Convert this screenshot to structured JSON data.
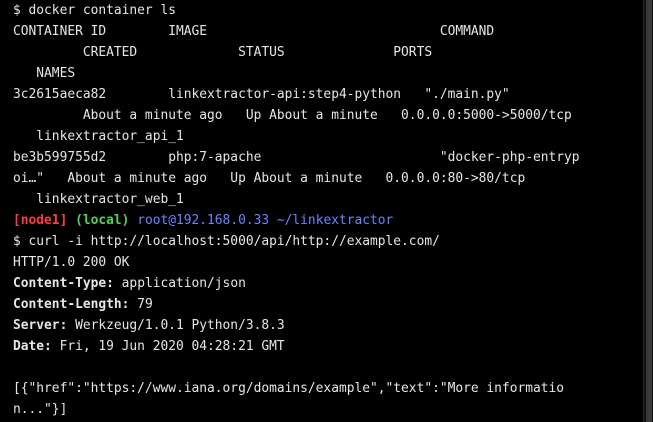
{
  "colors": {
    "background": "#000000",
    "text": "#e6e6e6",
    "node": "#ff3a3a",
    "local": "#52d452",
    "host": "#6a86ff"
  },
  "lines": {
    "l1": "$ docker container ls",
    "l2": "CONTAINER ID        IMAGE                              COMMAND",
    "l3": "         CREATED             STATUS              PORTS",
    "l4": "   NAMES",
    "l5": "3c2615aeca82        linkextractor-api:step4-python   \"./main.py\"",
    "l6": "         About a minute ago   Up About a minute   0.0.0.0:5000->5000/tcp",
    "l7": "   linkextractor_api_1",
    "l8": "be3b599755d2        php:7-apache                       \"docker-php-entryp",
    "l9": "oi…\"   About a minute ago   Up About a minute   0.0.0.0:80->80/tcp",
    "l10": "   linkextractor_web_1",
    "l12": "$ curl -i http://localhost:5000/api/http://example.com/",
    "l13": "HTTP/1.0 200 OK",
    "l18": "",
    "l19": "[{\"href\":\"https://www.iana.org/domains/example\",\"text\":\"More informatio",
    "l20": "n...\"}]"
  },
  "prompt": {
    "node": "[node1]",
    "local": "(local)",
    "host": "root@192.168.0.33",
    "path": " ~/linkextractor"
  },
  "headers": [
    {
      "key": "Content-Type:",
      "value": " application/json"
    },
    {
      "key": "Content-Length:",
      "value": " 79"
    },
    {
      "key": "Server:",
      "value": " Werkzeug/1.0.1 Python/3.8.3"
    },
    {
      "key": "Date:",
      "value": " Fri, 19 Jun 2020 04:28:21 GMT"
    }
  ]
}
